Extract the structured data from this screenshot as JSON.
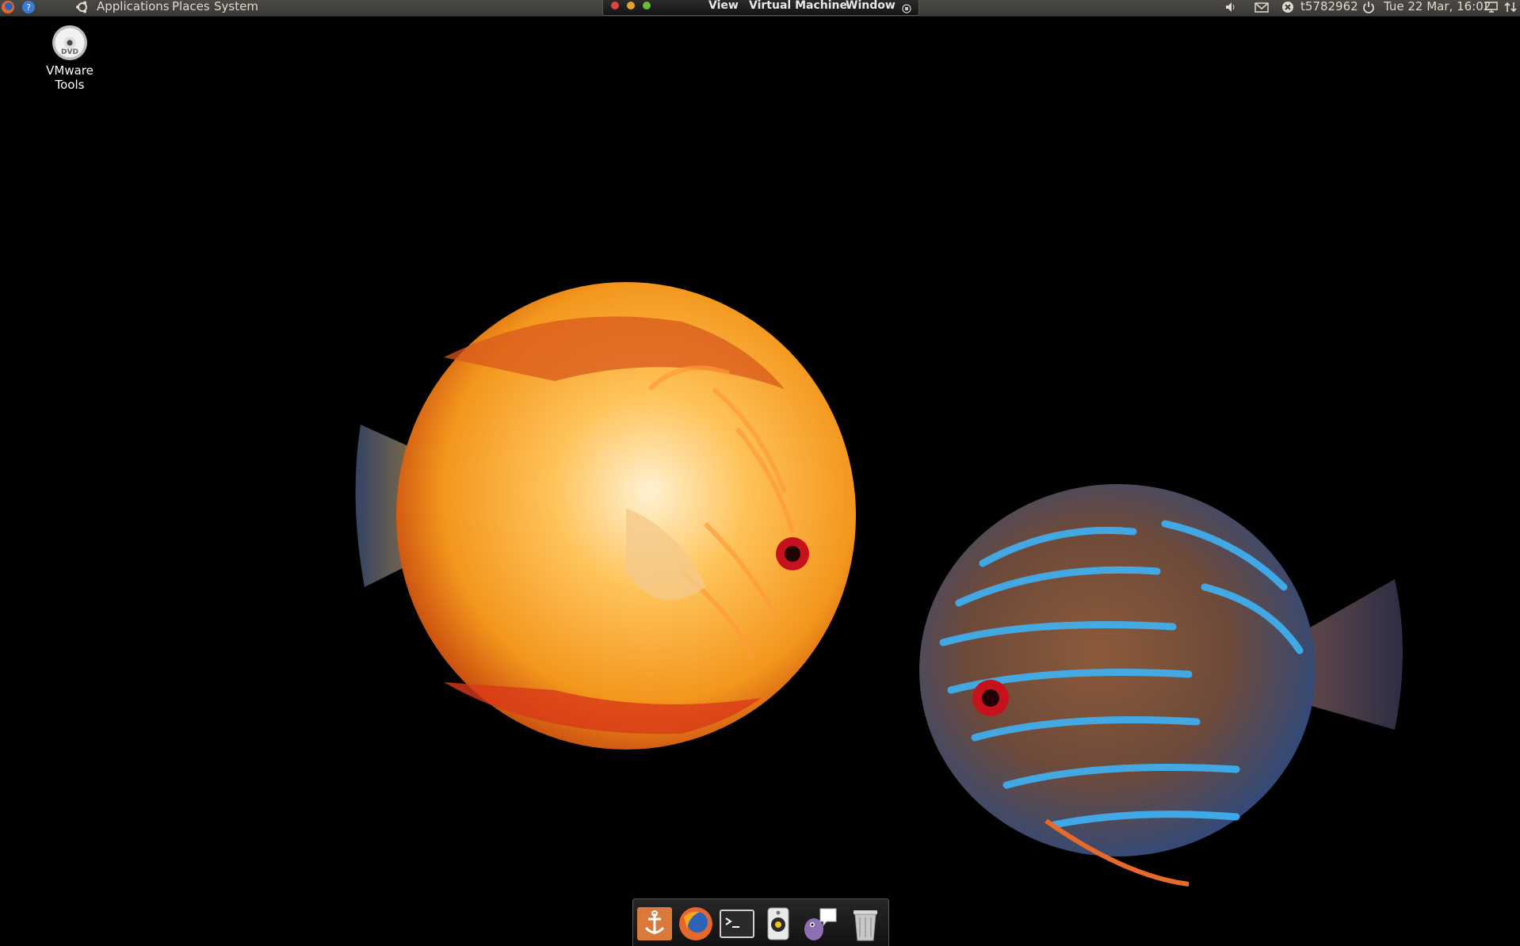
{
  "top_panel": {
    "menu": [
      "Applications",
      "Places",
      "System"
    ],
    "user": "t5782962",
    "clock": "Tue 22 Mar, 16:02",
    "tray_icons": [
      "volume-icon",
      "mail-icon",
      "status-icon",
      "power-icon",
      "display-icon",
      "network-icon"
    ]
  },
  "vm_bar": {
    "menu": [
      "View",
      "Virtual Machine",
      "Window"
    ]
  },
  "desktop": {
    "icons": [
      {
        "label": "VMware Tools",
        "icon": "dvd-icon",
        "disc_text": "DVD"
      }
    ]
  },
  "dock": {
    "items": [
      "anchor-icon",
      "firefox-icon",
      "terminal-icon",
      "speaker-icon",
      "pidgin-icon",
      "trash-icon"
    ]
  },
  "colors": {
    "panel": "#3f3e3a",
    "desktop_bg": "#000000",
    "gold_fish": "#f0a92a",
    "blue_fish": "#3aa8e8"
  }
}
